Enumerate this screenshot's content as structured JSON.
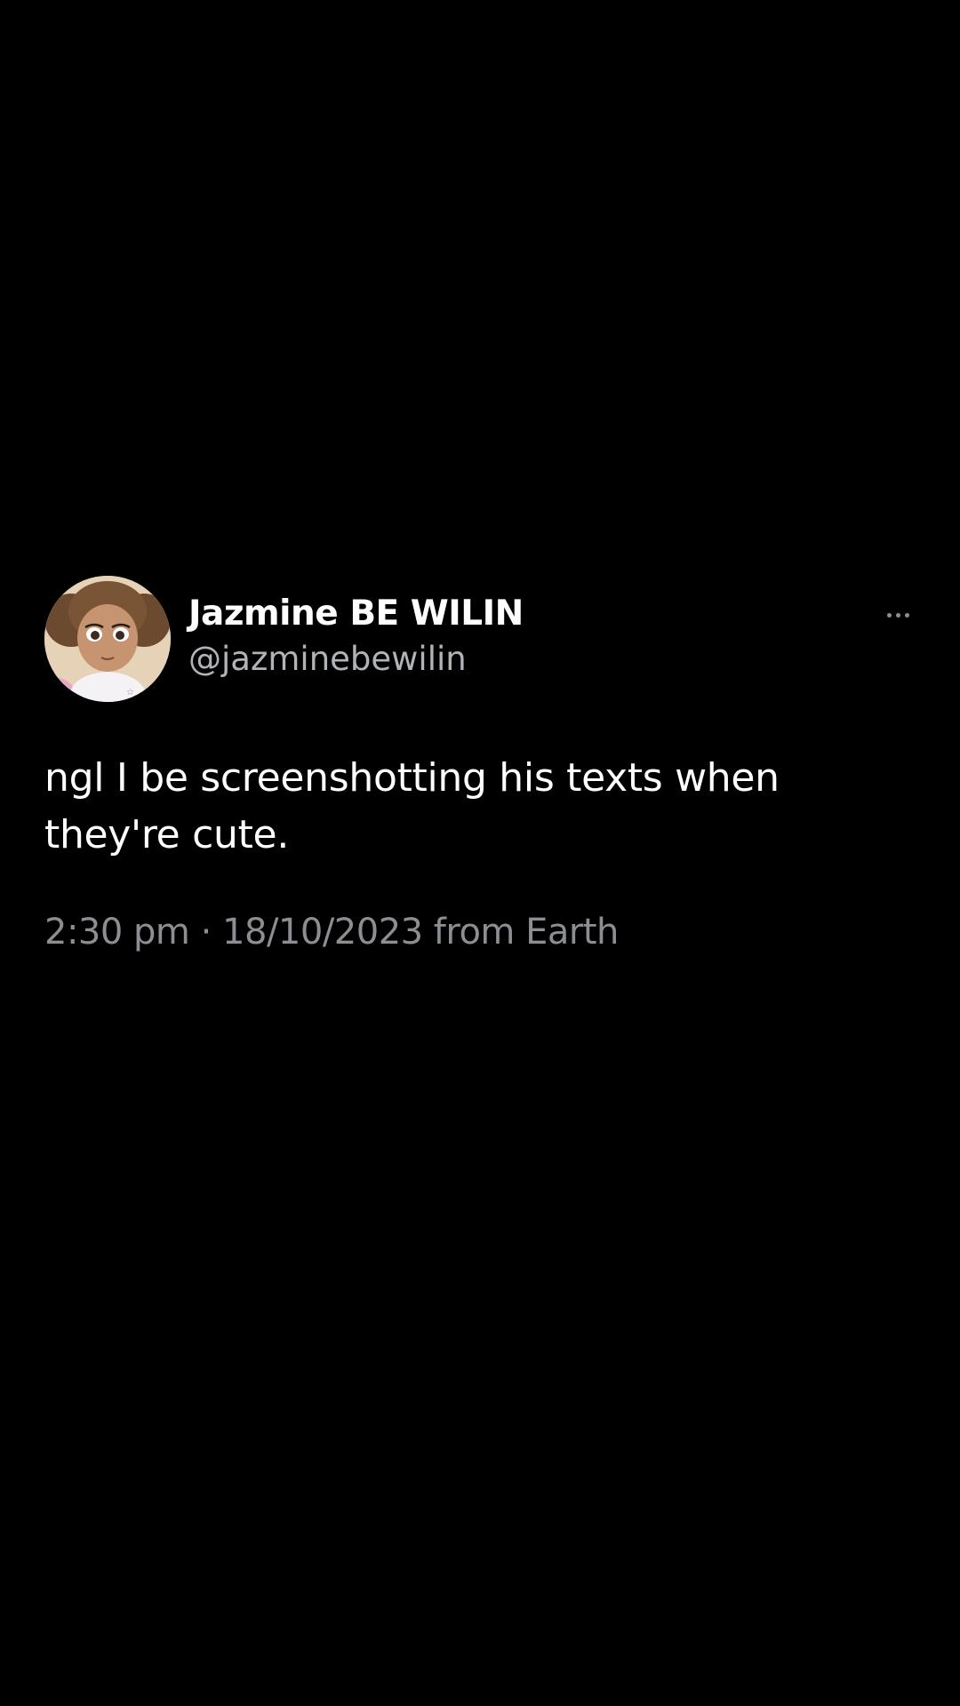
{
  "tweet": {
    "author": {
      "display_name": "Jazmine BE WILIN",
      "handle": "@jazminebewilin",
      "avatar_icon": "cartoon-girl-avatar"
    },
    "text": "ngl I be screenshotting his texts when they're cute.",
    "timestamp": "2:30 pm · 18/10/2023 from Earth",
    "more_icon": "more-options-icon"
  },
  "colors": {
    "background": "#000000",
    "primary_text": "#ffffff",
    "secondary_text": "#8b8f94"
  }
}
